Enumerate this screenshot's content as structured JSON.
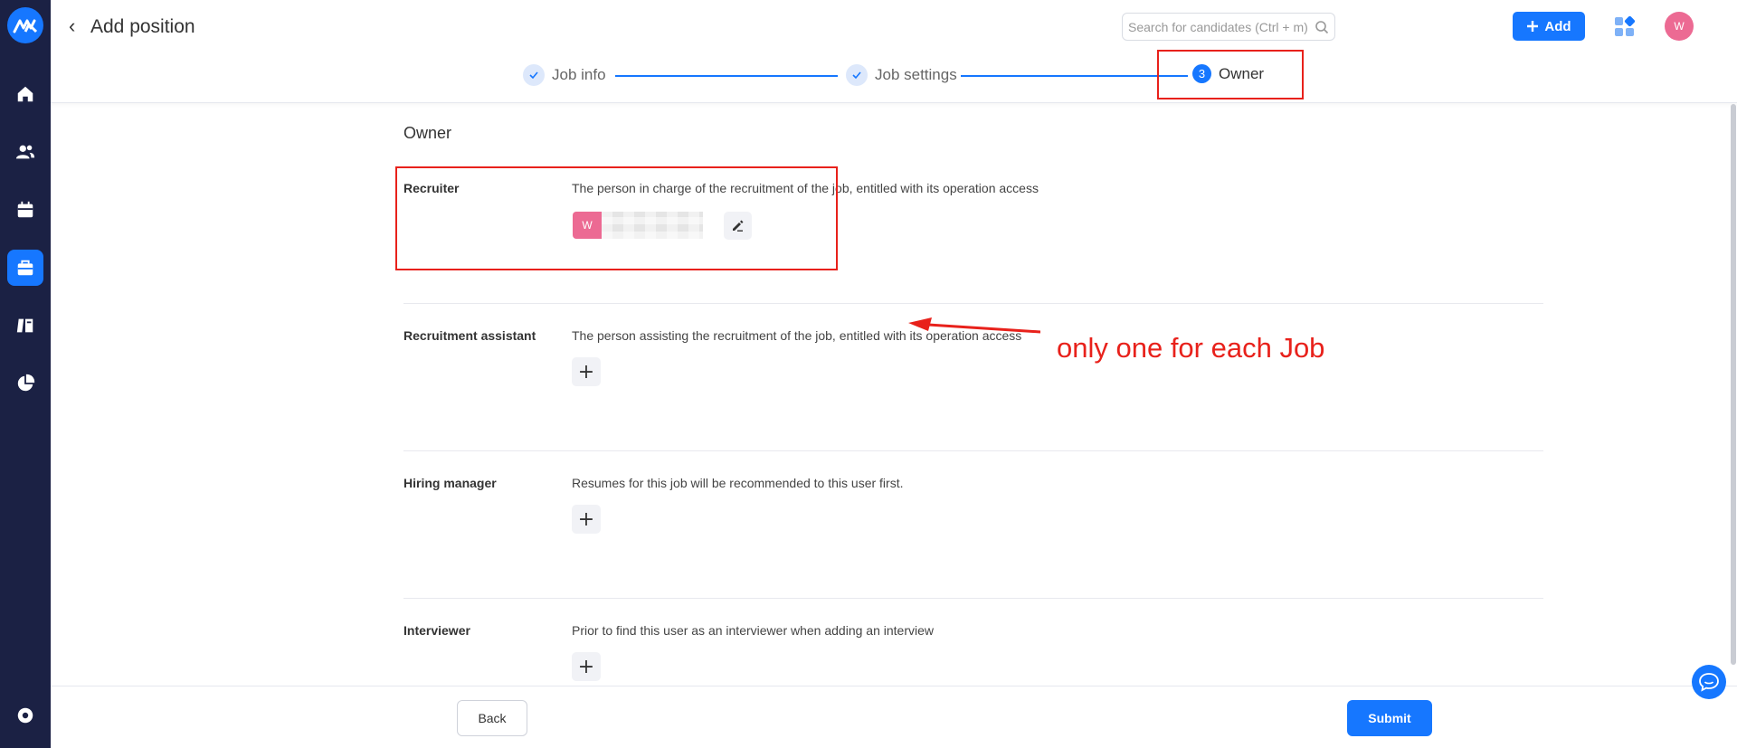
{
  "header": {
    "title": "Add position",
    "search_placeholder": "Search for candidates (Ctrl + m)",
    "add_label": "Add",
    "avatar_initial": "W"
  },
  "steps": [
    {
      "label": "Job info",
      "status": "done"
    },
    {
      "label": "Job settings",
      "status": "done"
    },
    {
      "label": "Owner",
      "status": "current",
      "number": "3"
    }
  ],
  "section": {
    "title": "Owner",
    "rows": [
      {
        "label": "Recruiter",
        "description": "The person in charge of the recruitment of the job, entitled with its operation access",
        "assigned_initial": "W"
      },
      {
        "label": "Recruitment assistant",
        "description": "The person assisting the recruitment of the job, entitled with its operation access"
      },
      {
        "label": "Hiring manager",
        "description": "Resumes for this job will be recommended to this user first."
      },
      {
        "label": "Interviewer",
        "description": "Prior to find this user as an interviewer when adding an interview"
      }
    ]
  },
  "annotation": {
    "text": "only one for each Job",
    "color": "#e8211b"
  },
  "footer": {
    "back_label": "Back",
    "submit_label": "Submit"
  },
  "colors": {
    "accent": "#1677ff",
    "sidebar": "#1b2144",
    "avatar": "#ec6a93"
  },
  "icons": {
    "sidebar": [
      "logo-icon",
      "home-icon",
      "people-icon",
      "calendar-icon",
      "briefcase-icon",
      "book-icon",
      "pie-chart-icon",
      "settings-icon"
    ],
    "header": [
      "back-arrow-icon",
      "search-icon",
      "plus-icon",
      "apps-icon"
    ]
  }
}
